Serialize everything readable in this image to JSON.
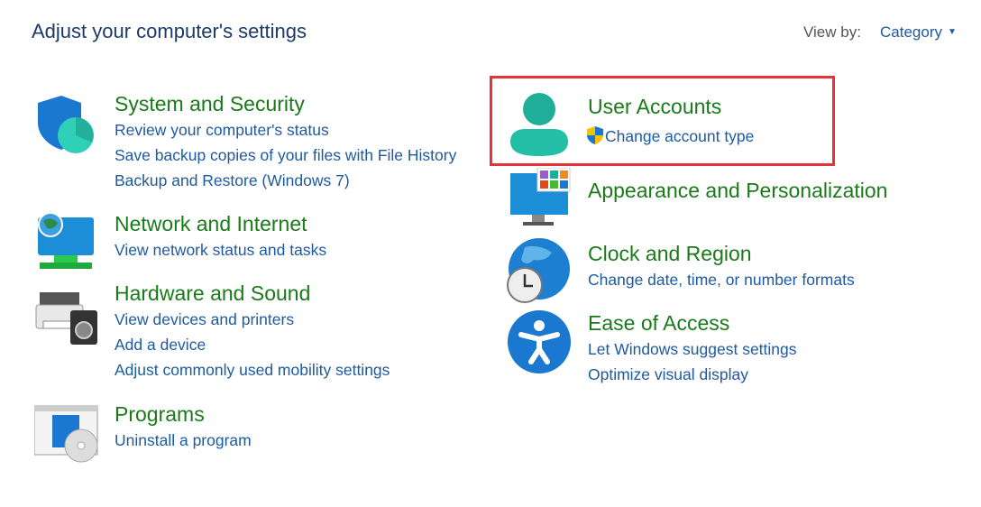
{
  "header": {
    "title": "Adjust your computer's settings",
    "view_by_label": "View by:",
    "view_by_value": "Category"
  },
  "categories": {
    "system": {
      "title": "System and Security",
      "links": [
        "Review your computer's status",
        "Save backup copies of your files with File History",
        "Backup and Restore (Windows 7)"
      ]
    },
    "network": {
      "title": "Network and Internet",
      "links": [
        "View network status and tasks"
      ]
    },
    "hardware": {
      "title": "Hardware and Sound",
      "links": [
        "View devices and printers",
        "Add a device",
        "Adjust commonly used mobility settings"
      ]
    },
    "programs": {
      "title": "Programs",
      "links": [
        "Uninstall a program"
      ]
    },
    "users": {
      "title": "User Accounts",
      "links": [
        "Change account type"
      ]
    },
    "appearance": {
      "title": "Appearance and Personalization",
      "links": []
    },
    "clock": {
      "title": "Clock and Region",
      "links": [
        "Change date, time, or number formats"
      ]
    },
    "ease": {
      "title": "Ease of Access",
      "links": [
        "Let Windows suggest settings",
        "Optimize visual display"
      ]
    }
  },
  "colors": {
    "heading": "#1a7a1a",
    "link": "#1e5aa0",
    "highlight": "#e8323a"
  }
}
